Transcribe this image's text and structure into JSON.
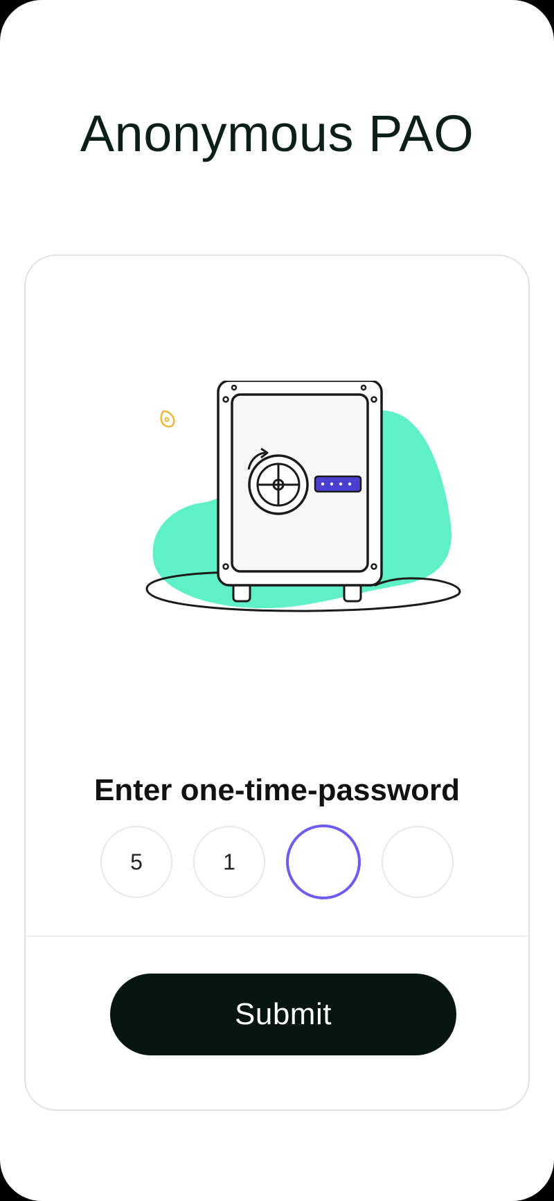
{
  "app": {
    "title": "Anonymous PAO"
  },
  "illustration": {
    "icon": "safe-illustration",
    "colors": {
      "blob": "#5ff0c7",
      "keypad": "#4b3fd0",
      "accent": "#f0b83a",
      "outline": "#1a1a1a"
    }
  },
  "otp": {
    "label": "Enter one-time-password",
    "digits": [
      "5",
      "1",
      "",
      ""
    ],
    "active_index": 2,
    "active_color": "#6c5cf0"
  },
  "actions": {
    "submit_label": "Submit",
    "submit_color": "#06150f"
  }
}
